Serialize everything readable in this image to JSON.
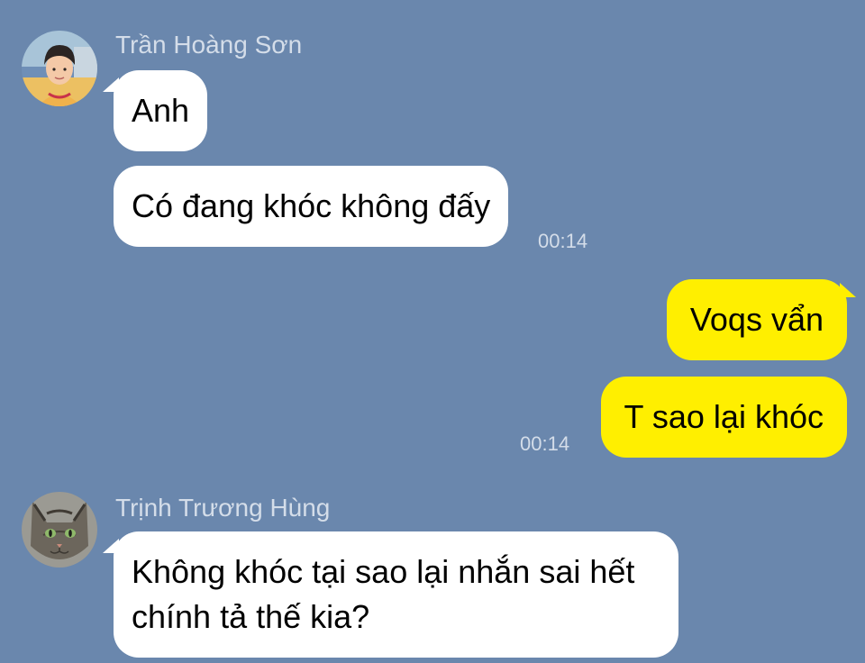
{
  "messages": [
    {
      "sender": "Trần Hoàng Sơn",
      "avatar_icon": "person-avatar-icon",
      "lines": [
        "Anh",
        "Có đang khóc không đấy"
      ],
      "time": "00:14"
    },
    {
      "sender": "",
      "outgoing": true,
      "lines": [
        "Voqs vẩn",
        "T sao lại khóc"
      ],
      "time": "00:14"
    },
    {
      "sender": "Trịnh Trương Hùng",
      "avatar_icon": "cat-avatar-icon",
      "lines": [
        "Không khóc tại sao lại nhắn sai hết\nchính tả thế kia?"
      ]
    }
  ],
  "colors": {
    "background": "#6a87ad",
    "incoming_bubble": "#ffffff",
    "outgoing_bubble": "#ffef00",
    "meta_text": "#d4dde9"
  }
}
